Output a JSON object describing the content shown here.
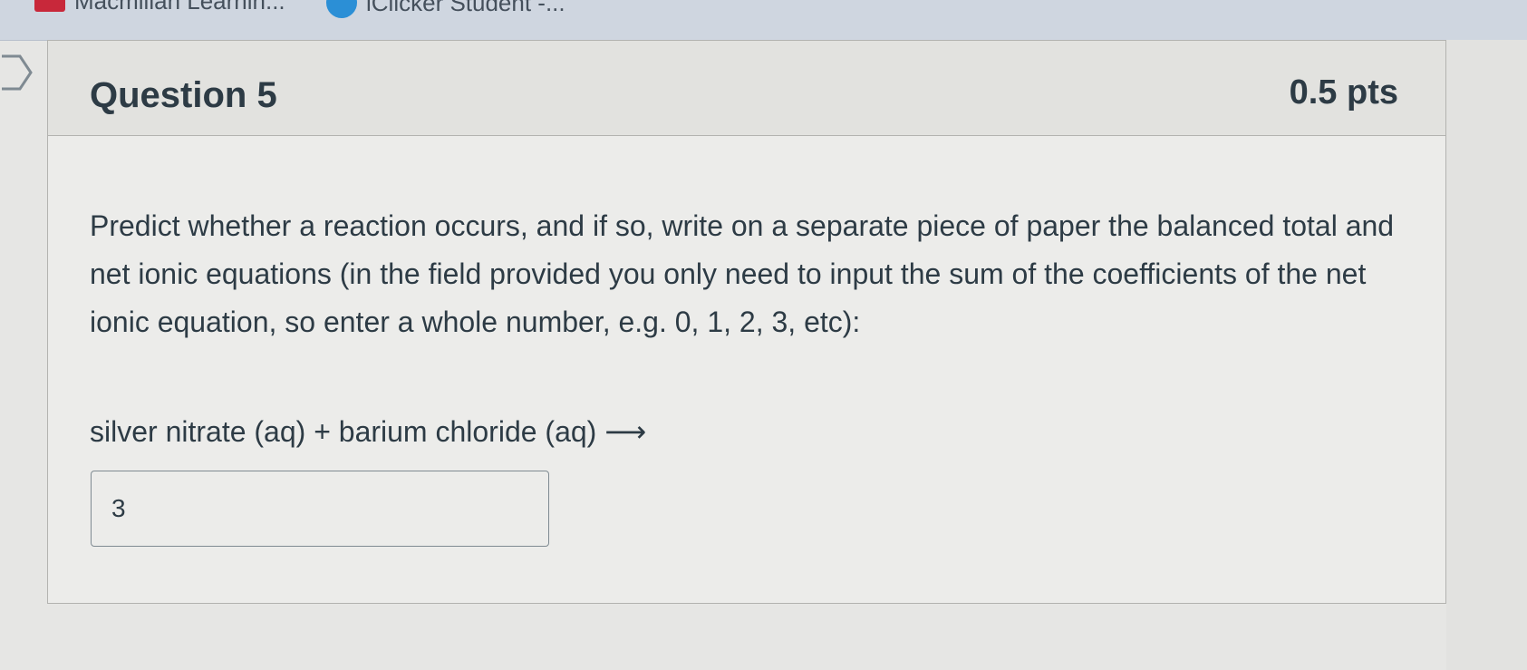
{
  "bookmarks": [
    {
      "label": "Macmillan Learnin...",
      "icon": "macmillan-icon"
    },
    {
      "label": "iClicker Student -...",
      "icon": "iclicker-icon"
    }
  ],
  "question": {
    "title": "Question 5",
    "points": "0.5 pts",
    "prompt": "Predict whether a reaction occurs, and if so, write on a separate piece of paper the balanced total and net ionic equations (in the field provided you only need to input the sum of the coefficients of the net ionic equation, so enter a whole number, e.g. 0, 1, 2, 3, etc):",
    "reaction": "silver nitrate (aq) + barium chloride (aq) ⟶",
    "answer_value": "3"
  }
}
